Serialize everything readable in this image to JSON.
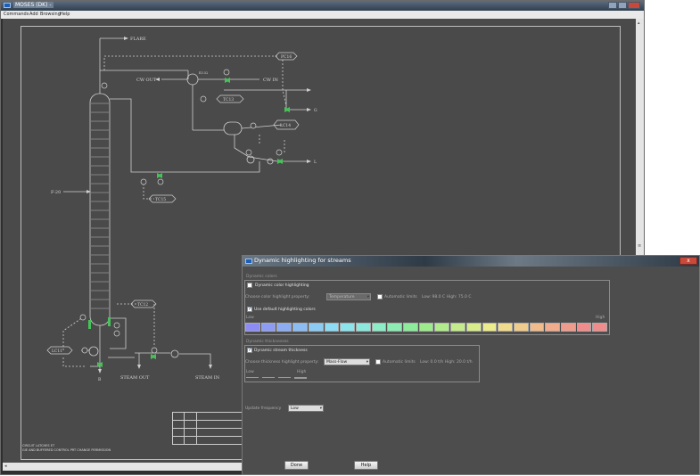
{
  "main": {
    "window_title": "MOSES (DK) - ",
    "menu": [
      "Commands",
      "Add",
      "Browsing",
      "Help"
    ],
    "diagram_labels": {
      "flare": "FLARE",
      "pc16": "PC16",
      "cw_out": "CW OUT",
      "cw_in": "CW IN",
      "e52": "E3.52",
      "tc13": "TC13",
      "lc14": "LC14",
      "g": "G",
      "l": "L",
      "feed": "F-20",
      "tc15": "TC15",
      "tc12": "TC12",
      "lc11": "LC11",
      "b": "B",
      "steam_out": "STEAM OUT",
      "steam_in": "STEAM IN"
    },
    "footer_note_1": "CIRCUIT LATCHES ET",
    "footer_note_2": "GIE AND BUFFERED CONTROL PRT CHANGE PERMISSION"
  },
  "dialog": {
    "title": "Dynamic highlighting for streams",
    "close_label": "x",
    "colors_group": {
      "title": "Dynamic colors",
      "enable_label": "Dynamic color highlighting",
      "enable_checked": false,
      "property_label": "Choose color highlight property:",
      "property_value": "Temperature",
      "auto_limits_label": "Automatic limits",
      "auto_limits_checked": false,
      "range_text": "Low: 98.0 C High: 75.0 C",
      "default_colors_label": "Use default highlighting colors",
      "default_colors_checked": true,
      "low_label": "Low",
      "high_label": "High",
      "swatches": [
        "#8c8cf4",
        "#8c9cf4",
        "#8cacf4",
        "#8cbcf4",
        "#8cccf4",
        "#8cdcf4",
        "#8ce4ec",
        "#8ce8dc",
        "#8cecc8",
        "#8cecb4",
        "#8cec9c",
        "#9cec8c",
        "#b0ec8c",
        "#c4ec8c",
        "#d8ec8c",
        "#ecec8c",
        "#f0dc8c",
        "#f0cc8c",
        "#f0bc8c",
        "#f0ac8c",
        "#f09c8c",
        "#f08c8c",
        "#f08c8c"
      ]
    },
    "thickness_group": {
      "title": "Dynamic thicknesses",
      "enable_label": "Dynamic stream thickness",
      "enable_checked": true,
      "property_label": "Choose thickness highlight property:",
      "property_value": "Mass-Flow",
      "auto_limits_label": "Automatic limits",
      "auto_limits_checked": false,
      "range_text": "Low: 0.0 t/h High: 20.0 t/h",
      "low_label": "Low",
      "high_label": "High"
    },
    "update_frequency_label": "Update frequency",
    "update_frequency_value": "Low",
    "done_label": "Done",
    "help_label": "Help"
  }
}
